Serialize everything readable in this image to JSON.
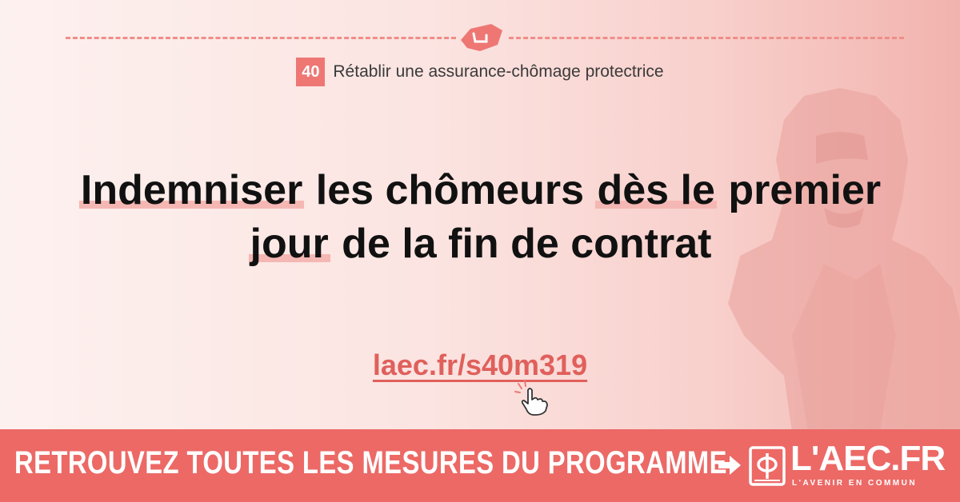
{
  "measure": {
    "number": "40",
    "title": "Rétablir une assurance-chômage protectrice"
  },
  "headline": {
    "line1": {
      "w1": "Indemniser",
      "w2": " les chômeurs ",
      "w3": "dès le",
      "w4": " premier"
    },
    "line2": {
      "w1": "jour",
      "w2": " de la fin de contrat"
    }
  },
  "link": {
    "text": "laec.fr/s40m319"
  },
  "banner": {
    "text": "RETROUVEZ TOUTES LES MESURES DU PROGRAMME",
    "logo_text": "L'AEC.FR",
    "logo_tagline": "L'AVENIR EN COMMUN"
  },
  "icons": {
    "top": "handshake-icon",
    "link": "pointer-hand-icon",
    "banner_arrow": "arrow-right-icon",
    "logo": "phi-book-icon"
  },
  "colors": {
    "accent": "#ec6966",
    "highlight": "#f5b7b3",
    "text": "#111111",
    "link": "#e0605c"
  }
}
